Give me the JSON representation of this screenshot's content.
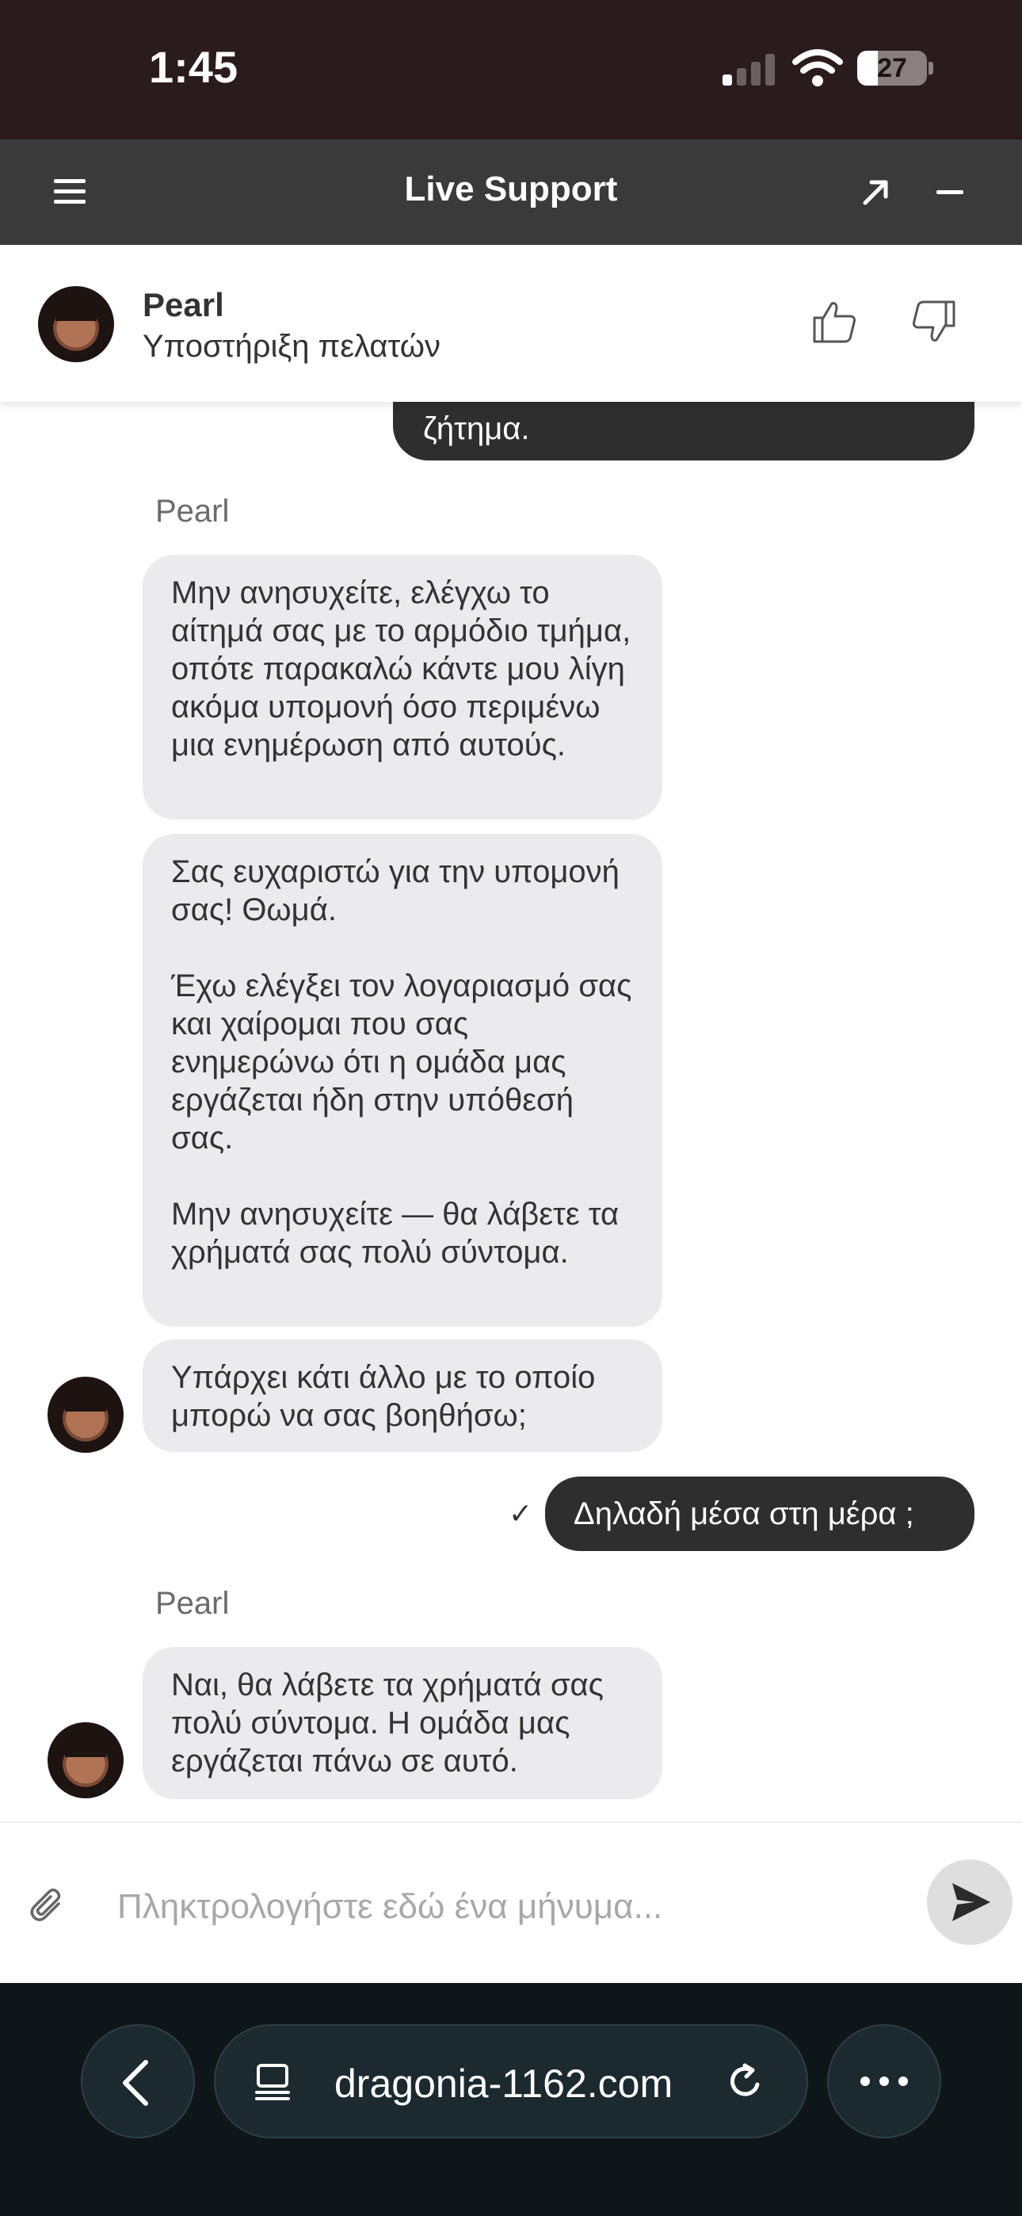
{
  "status_bar": {
    "time": "1:45",
    "battery": "27"
  },
  "header": {
    "title": "Live Support"
  },
  "agent": {
    "name": "Pearl",
    "role": "Υποστήριξη πελατών"
  },
  "messages": {
    "partial_user": "ζήτημα.",
    "sender_1": "Pearl",
    "agent_1": "Μην ανησυχείτε, ελέγχω το αίτημά σας με το αρμόδιο τμήμα, οπότε παρακαλώ κάντε μου λίγη ακόμα υπομονή όσο περιμένω μια ενημέρωση από αυτούς.",
    "agent_2": "Σας ευχαριστώ για την υπομονή σας! Θωμά.\n\nΈχω ελέγξει τον λογαριασμό σας και χαίρομαι που σας ενημερώνω ότι η ομάδα μας εργάζεται ήδη στην υπόθεσή σας.\n\nΜην ανησυχείτε — θα λάβετε τα χρήματά σας πολύ σύντομα.",
    "agent_3": "Υπάρχει κάτι άλλο με το οποίο μπορώ να σας βοηθήσω;",
    "user_1": "Δηλαδή μέσα στη μέρα ;",
    "sender_2": "Pearl",
    "agent_4": "Ναι, θα λάβετε τα χρήματά σας πολύ σύντομα. Η ομάδα μας εργάζεται πάνω σε αυτό."
  },
  "composer": {
    "placeholder": "Πληκτρολογήστε εδώ ένα μήνυμα..."
  },
  "browser": {
    "url": "dragonia-1162.com"
  }
}
